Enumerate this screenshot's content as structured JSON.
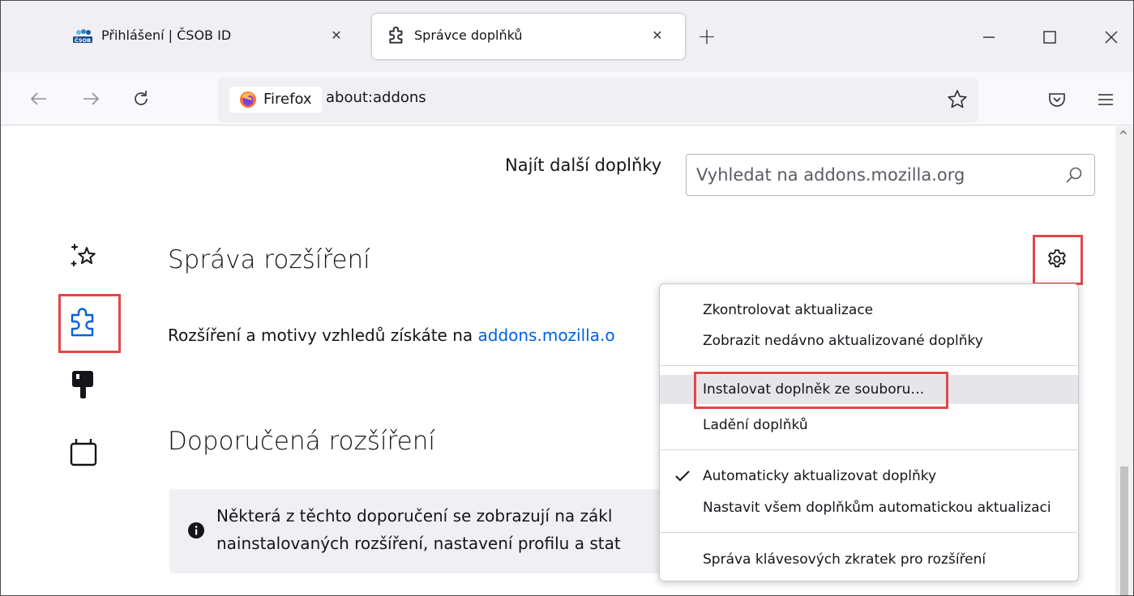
{
  "tabs": [
    {
      "title": "Přihlášení | ČSOB ID",
      "icon": "csob-logo-icon",
      "active": false,
      "close": "✕"
    },
    {
      "title": "Správce doplňků",
      "icon": "puzzle-icon",
      "active": true,
      "close": "✕"
    }
  ],
  "new_tab": "+",
  "nav": {
    "identity_label": "Firefox",
    "url": "about:addons"
  },
  "search": {
    "label": "Najít další doplňky",
    "placeholder": "Vyhledat na addons.mozilla.org"
  },
  "sidebar": {
    "items": [
      {
        "name": "recommendations",
        "icon": "sparkle-star-icon"
      },
      {
        "name": "extensions",
        "icon": "puzzle-icon",
        "selected": true
      },
      {
        "name": "themes",
        "icon": "paintbrush-icon"
      },
      {
        "name": "plugins",
        "icon": "plugin-icon"
      }
    ]
  },
  "main": {
    "heading_manage": "Správa rozšíření",
    "desc_prefix": "Rozšíření a motivy vzhledů získáte na ",
    "desc_link": "addons.mozilla.o",
    "heading_recommended": "Doporučená rozšíření",
    "info_line1": "Některá z těchto doporučení se zobrazují na zákl",
    "info_line2": "nainstalovaných rozšíření, nastavení profilu a stat"
  },
  "menu": {
    "items": [
      {
        "label": "Zkontrolovat aktualizace"
      },
      {
        "label": "Zobrazit nedávno aktualizované doplňky"
      },
      {
        "label": "Instalovat doplněk ze souboru…",
        "highlighted": true
      },
      {
        "label": "Ladění doplňků"
      },
      {
        "label": "Automaticky aktualizovat doplňky",
        "checked": true
      },
      {
        "label": "Nastavit všem doplňkům automatickou aktualizaci"
      },
      {
        "label": "Správa klávesových zkratek pro rozšíření"
      }
    ]
  },
  "colors": {
    "accent": "#0061e0",
    "highlight_box": "#e04848",
    "tabstrip_bg": "#f0f0f4"
  }
}
